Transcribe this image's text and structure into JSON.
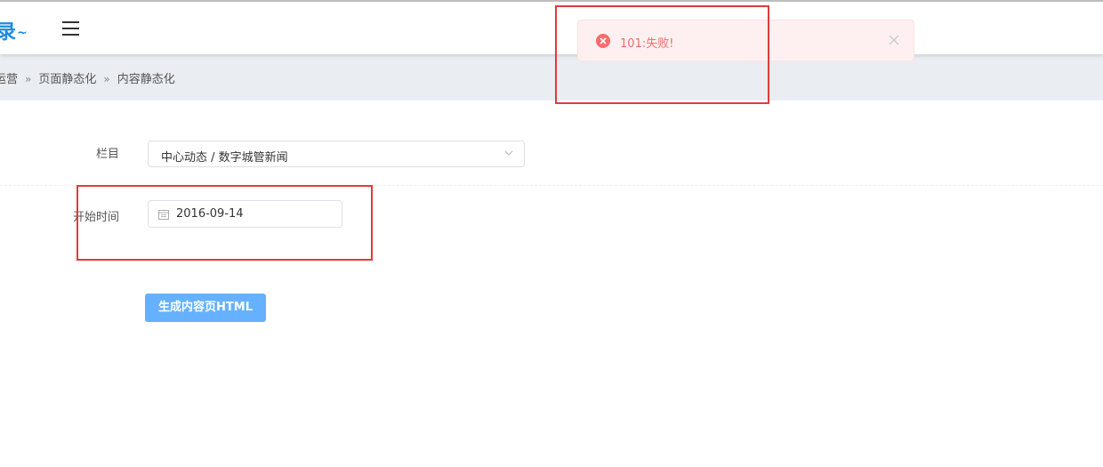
{
  "header": {
    "logo_fragment": "录",
    "logo_tilde": "~"
  },
  "breadcrumb": {
    "items": [
      "运营",
      "页面静态化",
      "内容静态化"
    ],
    "separator": "»"
  },
  "form": {
    "column_label": "栏目",
    "column_value": "中心动态 / 数字城管新闻",
    "start_time_label": "开始时间",
    "start_time_value": "2016-09-14",
    "generate_button_label": "生成内容页HTML"
  },
  "toast": {
    "type": "error",
    "message": "101:失败!"
  },
  "icons": {
    "menu": "hamburger-icon",
    "chevron": "chevron-down-icon",
    "calendar": "calendar-icon",
    "toast_error": "error-circle-icon",
    "toast_close": "close-icon"
  },
  "colors": {
    "brand": "#1f8ae0",
    "primary_button": "#66b1ff",
    "error_text": "#f56c6c",
    "error_bg": "#fef0f0",
    "highlight": "#e03b3b",
    "breadcrumb_bg": "#eaedf1"
  }
}
